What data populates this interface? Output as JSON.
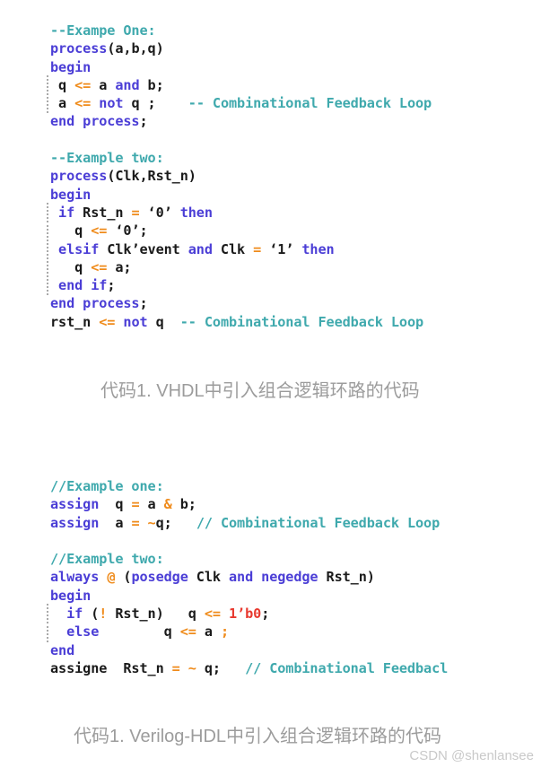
{
  "page": {
    "background_color": "#ffffff",
    "watermark": "CSDN @shenlansee"
  },
  "colors": {
    "keyword": "#4b3ed6",
    "comment": "#3fa9ad",
    "operator": "#ef8b1b",
    "number": "#e8392f",
    "plain": "#1a1a1a",
    "caption": "#9c9c9c",
    "watermark": "#c9c9c9"
  },
  "vhdl_block": {
    "language": "VHDL",
    "lines": [
      {
        "id": "v1",
        "tokens": [
          {
            "t": "--Exampe One:",
            "c": "cmt"
          }
        ]
      },
      {
        "id": "v2",
        "tokens": [
          {
            "t": "process",
            "c": "kw"
          },
          {
            "t": "(a,b,q)",
            "c": "txt"
          }
        ]
      },
      {
        "id": "v3",
        "tokens": [
          {
            "t": "begin",
            "c": "kw"
          }
        ]
      },
      {
        "id": "v4",
        "guide": true,
        "tokens": [
          {
            "t": " q ",
            "c": "txt"
          },
          {
            "t": "<=",
            "c": "op"
          },
          {
            "t": " a ",
            "c": "txt"
          },
          {
            "t": "and",
            "c": "kw"
          },
          {
            "t": " b;",
            "c": "txt"
          }
        ]
      },
      {
        "id": "v5",
        "guide": true,
        "tokens": [
          {
            "t": " a ",
            "c": "txt"
          },
          {
            "t": "<=",
            "c": "op"
          },
          {
            "t": " ",
            "c": "txt"
          },
          {
            "t": "not",
            "c": "kw"
          },
          {
            "t": " q ;    ",
            "c": "txt"
          },
          {
            "t": "-- Combinational Feedback Loop",
            "c": "cmt"
          }
        ]
      },
      {
        "id": "v6",
        "tokens": [
          {
            "t": "end process",
            "c": "kw"
          },
          {
            "t": ";",
            "c": "txt"
          }
        ]
      },
      {
        "id": "v7",
        "blank": true,
        "tokens": []
      },
      {
        "id": "v8",
        "tokens": [
          {
            "t": "--Example two:",
            "c": "cmt"
          }
        ]
      },
      {
        "id": "v9",
        "tokens": [
          {
            "t": "process",
            "c": "kw"
          },
          {
            "t": "(Clk,Rst_n)",
            "c": "txt"
          }
        ]
      },
      {
        "id": "v10",
        "tokens": [
          {
            "t": "begin",
            "c": "kw"
          }
        ]
      },
      {
        "id": "v11",
        "guide": true,
        "tokens": [
          {
            "t": " ",
            "c": "txt"
          },
          {
            "t": "if",
            "c": "kw"
          },
          {
            "t": " Rst_n ",
            "c": "txt"
          },
          {
            "t": "=",
            "c": "op"
          },
          {
            "t": " ‘0’ ",
            "c": "txt"
          },
          {
            "t": "then",
            "c": "kw"
          }
        ]
      },
      {
        "id": "v12",
        "guide": true,
        "tokens": [
          {
            "t": "   q ",
            "c": "txt"
          },
          {
            "t": "<=",
            "c": "op"
          },
          {
            "t": " ‘0’;",
            "c": "txt"
          }
        ]
      },
      {
        "id": "v13",
        "guide": true,
        "tokens": [
          {
            "t": " ",
            "c": "txt"
          },
          {
            "t": "elsif",
            "c": "kw"
          },
          {
            "t": " Clk’event ",
            "c": "txt"
          },
          {
            "t": "and",
            "c": "kw"
          },
          {
            "t": " Clk ",
            "c": "txt"
          },
          {
            "t": "=",
            "c": "op"
          },
          {
            "t": " ‘1’ ",
            "c": "txt"
          },
          {
            "t": "then",
            "c": "kw"
          }
        ]
      },
      {
        "id": "v14",
        "guide": true,
        "tokens": [
          {
            "t": "   q ",
            "c": "txt"
          },
          {
            "t": "<=",
            "c": "op"
          },
          {
            "t": " a;",
            "c": "txt"
          }
        ]
      },
      {
        "id": "v15",
        "guide": true,
        "tokens": [
          {
            "t": " ",
            "c": "txt"
          },
          {
            "t": "end if",
            "c": "kw"
          },
          {
            "t": ";",
            "c": "txt"
          }
        ]
      },
      {
        "id": "v16",
        "tokens": [
          {
            "t": "end process",
            "c": "kw"
          },
          {
            "t": ";",
            "c": "txt"
          }
        ]
      },
      {
        "id": "v17",
        "tokens": [
          {
            "t": "rst_n ",
            "c": "txt"
          },
          {
            "t": "<=",
            "c": "op"
          },
          {
            "t": " ",
            "c": "txt"
          },
          {
            "t": "not",
            "c": "kw"
          },
          {
            "t": " q  ",
            "c": "txt"
          },
          {
            "t": "-- Combinational Feedback Loop",
            "c": "cmt"
          }
        ]
      }
    ]
  },
  "verilog_block": {
    "language": "Verilog-HDL",
    "lines": [
      {
        "id": "g1",
        "tokens": [
          {
            "t": "//Example one:",
            "c": "cmt"
          }
        ]
      },
      {
        "id": "g2",
        "tokens": [
          {
            "t": "assign",
            "c": "kw"
          },
          {
            "t": "  q ",
            "c": "txt"
          },
          {
            "t": "=",
            "c": "op"
          },
          {
            "t": " a ",
            "c": "txt"
          },
          {
            "t": "&",
            "c": "op"
          },
          {
            "t": " b;",
            "c": "txt"
          }
        ]
      },
      {
        "id": "g3",
        "tokens": [
          {
            "t": "assign",
            "c": "kw"
          },
          {
            "t": "  a ",
            "c": "txt"
          },
          {
            "t": "=",
            "c": "op"
          },
          {
            "t": " ",
            "c": "txt"
          },
          {
            "t": "~",
            "c": "op"
          },
          {
            "t": "q;   ",
            "c": "txt"
          },
          {
            "t": "// Combinational Feedback Loop",
            "c": "cmt"
          }
        ]
      },
      {
        "id": "g4",
        "blank": true,
        "tokens": []
      },
      {
        "id": "g5",
        "tokens": [
          {
            "t": "//Example two:",
            "c": "cmt"
          }
        ]
      },
      {
        "id": "g6",
        "tokens": [
          {
            "t": "always",
            "c": "kw"
          },
          {
            "t": " ",
            "c": "txt"
          },
          {
            "t": "@",
            "c": "op"
          },
          {
            "t": " (",
            "c": "txt"
          },
          {
            "t": "posedge",
            "c": "kw"
          },
          {
            "t": " Clk ",
            "c": "txt"
          },
          {
            "t": "and",
            "c": "kw"
          },
          {
            "t": " ",
            "c": "txt"
          },
          {
            "t": "negedge",
            "c": "kw"
          },
          {
            "t": " Rst_n)",
            "c": "txt"
          }
        ]
      },
      {
        "id": "g7",
        "tokens": [
          {
            "t": "begin",
            "c": "kw"
          }
        ]
      },
      {
        "id": "g8",
        "guide": true,
        "tokens": [
          {
            "t": "  ",
            "c": "txt"
          },
          {
            "t": "if",
            "c": "kw"
          },
          {
            "t": " (",
            "c": "txt"
          },
          {
            "t": "!",
            "c": "op"
          },
          {
            "t": " Rst_n)   q ",
            "c": "txt"
          },
          {
            "t": "<=",
            "c": "op"
          },
          {
            "t": " ",
            "c": "txt"
          },
          {
            "t": "1’b0",
            "c": "num"
          },
          {
            "t": ";",
            "c": "txt"
          }
        ]
      },
      {
        "id": "g9",
        "guide": true,
        "tokens": [
          {
            "t": "  ",
            "c": "txt"
          },
          {
            "t": "else",
            "c": "kw"
          },
          {
            "t": "        q ",
            "c": "txt"
          },
          {
            "t": "<=",
            "c": "op"
          },
          {
            "t": " a ",
            "c": "txt"
          },
          {
            "t": ";",
            "c": "op"
          }
        ]
      },
      {
        "id": "g10",
        "tokens": [
          {
            "t": "end",
            "c": "kw"
          }
        ]
      },
      {
        "id": "g11",
        "tokens": [
          {
            "t": "assigne  Rst_n ",
            "c": "txt"
          },
          {
            "t": "=",
            "c": "op"
          },
          {
            "t": " ",
            "c": "txt"
          },
          {
            "t": "~",
            "c": "op"
          },
          {
            "t": " q;   ",
            "c": "txt"
          },
          {
            "t": "// Combinational Feedbacl",
            "c": "cmt"
          }
        ]
      }
    ]
  },
  "captions": {
    "vhdl": "代码1. VHDL中引入组合逻辑环路的代码",
    "verilog": "代码1. Verilog-HDL中引入组合逻辑环路的代码"
  }
}
